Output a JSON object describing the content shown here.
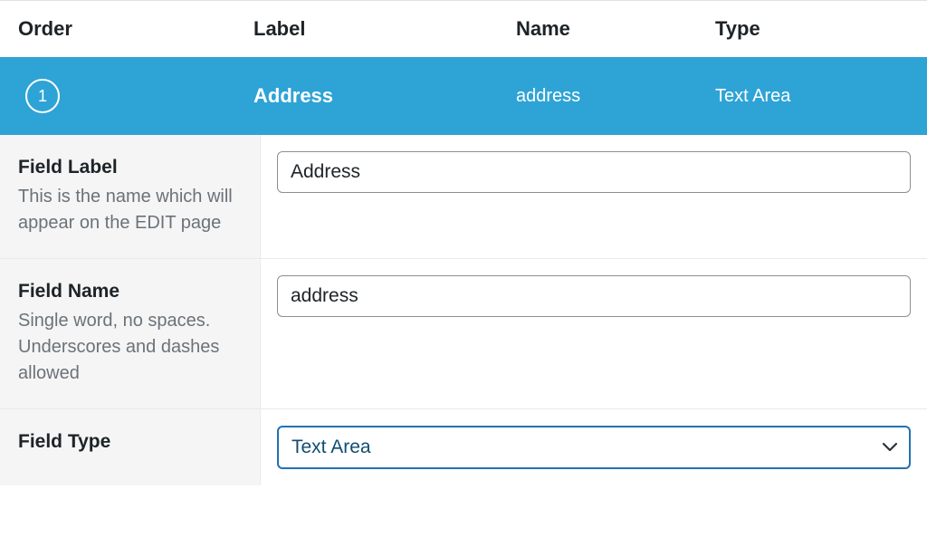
{
  "headers": {
    "order": "Order",
    "label": "Label",
    "name": "Name",
    "type": "Type"
  },
  "row": {
    "order": "1",
    "label": "Address",
    "name": "address",
    "type": "Text Area"
  },
  "fields": {
    "label": {
      "title": "Field Label",
      "desc": "This is the name which will appear on the EDIT page",
      "value": "Address"
    },
    "name": {
      "title": "Field Name",
      "desc": "Single word, no spaces. Underscores and dashes allowed",
      "value": "address"
    },
    "type": {
      "title": "Field Type",
      "value": "Text Area"
    }
  }
}
